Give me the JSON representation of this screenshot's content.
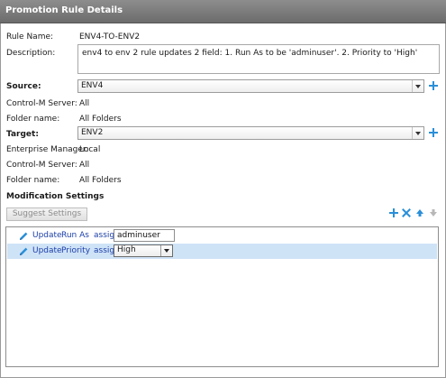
{
  "window": {
    "title": "Promotion Rule Details"
  },
  "rule": {
    "name_label": "Rule Name:",
    "name_value": "ENV4-TO-ENV2",
    "description_label": "Description:",
    "description_value": "env4 to env 2 rule updates 2 field: 1. Run As to be 'adminuser'. 2. Priority to 'High'"
  },
  "source": {
    "label": "Source:",
    "selected": "ENV4",
    "controlm_label": "Control-M Server:",
    "controlm_value": "All",
    "folder_label": "Folder name:",
    "folder_value": "All Folders"
  },
  "target": {
    "label": "Target:",
    "selected": "ENV2",
    "em_label": "Enterprise Manager:",
    "em_value": "Local",
    "controlm_label": "Control-M Server:",
    "controlm_value": "All",
    "folder_label": "Folder name:",
    "folder_value": "All Folders"
  },
  "modification": {
    "heading": "Modification Settings",
    "suggest_button": "Suggest Settings",
    "rows": [
      {
        "action": "Update",
        "field": "Run As",
        "op": "assign",
        "value": "adminuser",
        "control": "input",
        "selected": false
      },
      {
        "action": "Update",
        "field": "Priority",
        "op": "assign",
        "value": "High",
        "control": "select",
        "selected": true
      }
    ]
  },
  "icons": {
    "add": "plus-icon",
    "remove": "x-icon",
    "move_up": "arrow-up-icon",
    "move_down": "arrow-down-icon",
    "edit": "pencil-icon"
  },
  "colors": {
    "accent": "#2a8fd9",
    "title_bar": "#7a7a7a",
    "link_text": "#1c3fa8",
    "row_selected": "#cfe3f7"
  }
}
